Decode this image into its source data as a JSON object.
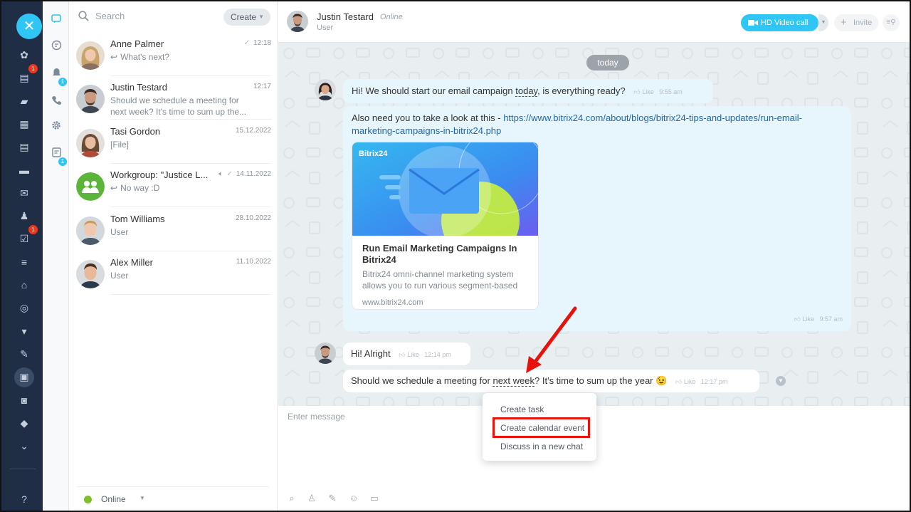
{
  "rail": {
    "close_icon": "close-icon",
    "items": [
      {
        "icon": "activity-icon",
        "glyph": "✿"
      },
      {
        "icon": "news-icon",
        "glyph": "▤",
        "badge": "1"
      },
      {
        "icon": "chat-icon",
        "glyph": "▰"
      },
      {
        "icon": "calendar-icon",
        "glyph": "▦"
      },
      {
        "icon": "document-icon",
        "glyph": "▤"
      },
      {
        "icon": "drive-icon",
        "glyph": "▬"
      },
      {
        "icon": "mail-icon",
        "glyph": "✉"
      },
      {
        "icon": "group-icon",
        "glyph": "♟"
      },
      {
        "icon": "task-icon",
        "glyph": "☑",
        "badge": "1"
      },
      {
        "icon": "filter-icon",
        "glyph": "≡"
      },
      {
        "icon": "sites-icon",
        "glyph": "⌂"
      },
      {
        "icon": "target-icon",
        "glyph": "◎"
      },
      {
        "icon": "cart-icon",
        "glyph": "▾"
      },
      {
        "icon": "sign-icon",
        "glyph": "✎"
      },
      {
        "icon": "contact-card-icon",
        "glyph": "▣"
      },
      {
        "icon": "robot-icon",
        "glyph": "◙"
      },
      {
        "icon": "box-icon",
        "glyph": "◆"
      },
      {
        "icon": "more-icon",
        "glyph": "⌄"
      }
    ],
    "help_icon": "?"
  },
  "tools": {
    "badges": {
      "notifications": "1",
      "tasks": "1"
    }
  },
  "chatlist": {
    "search_placeholder": "Search",
    "create_label": "Create",
    "items": [
      {
        "name": "Anne Palmer",
        "time": "12:18",
        "sub": "What's next?",
        "reply": true,
        "read": true
      },
      {
        "name": "Justin Testard",
        "time": "12:17",
        "sub": "Should we schedule a meeting for next week? It's time to sum up the..."
      },
      {
        "name": "Tasi Gordon",
        "time": "15.12.2022",
        "sub": "[File]"
      },
      {
        "name": "Workgroup: \"Justice L...",
        "time": "14.11.2022",
        "sub": "No way :D",
        "reply": true,
        "muted": true,
        "read": true
      },
      {
        "name": "Tom Williams",
        "time": "28.10.2022",
        "sub": "User"
      },
      {
        "name": "Alex Miller",
        "time": "11.10.2022",
        "sub": "User"
      }
    ],
    "status_label": "Online"
  },
  "header": {
    "name": "Justin Testard",
    "online": "Online",
    "role": "User",
    "video_label": "HD Video call",
    "invite_label": "Invite"
  },
  "messages": {
    "date": "today",
    "m1": {
      "pre": "Hi! We should start our email campaign ",
      "marked": "today",
      "post": ", is everything ready?",
      "like": "Like",
      "time": "9:55 am"
    },
    "m2": {
      "pre": "Also need you to take a look at this - ",
      "link": "https://www.bitrix24.com/about/blogs/bitrix24-tips-and-updates/run-email-marketing-campaigns-in-bitrix24.php",
      "like": "Like",
      "time": "9:57 am"
    },
    "card": {
      "brand": "Bitrix24",
      "title": "Run Email Marketing Campaigns In Bitrix24",
      "desc": "Bitrix24 omni-channel marketing system allows you to run various segment-based",
      "site": "www.bitrix24.com"
    },
    "m3": {
      "text": "Hi! Alright",
      "like": "Like",
      "time": "12:14 pm"
    },
    "m4": {
      "pre": "Should we schedule a meeting for ",
      "marked": "next week",
      "post": "? It's time to sum up the year",
      "emoji": "😉",
      "like": "Like",
      "time": "12:17 pm"
    }
  },
  "input": {
    "placeholder": "Enter message"
  },
  "context_menu": {
    "items": [
      "Create task",
      "Create calendar event",
      "Discuss in a new chat"
    ],
    "highlighted_index": 1
  },
  "colors": {
    "accent": "#2fc6f6",
    "rail": "#1f2e45",
    "highlight": "#e8120c",
    "bubble_out": "#e7f6fc"
  }
}
